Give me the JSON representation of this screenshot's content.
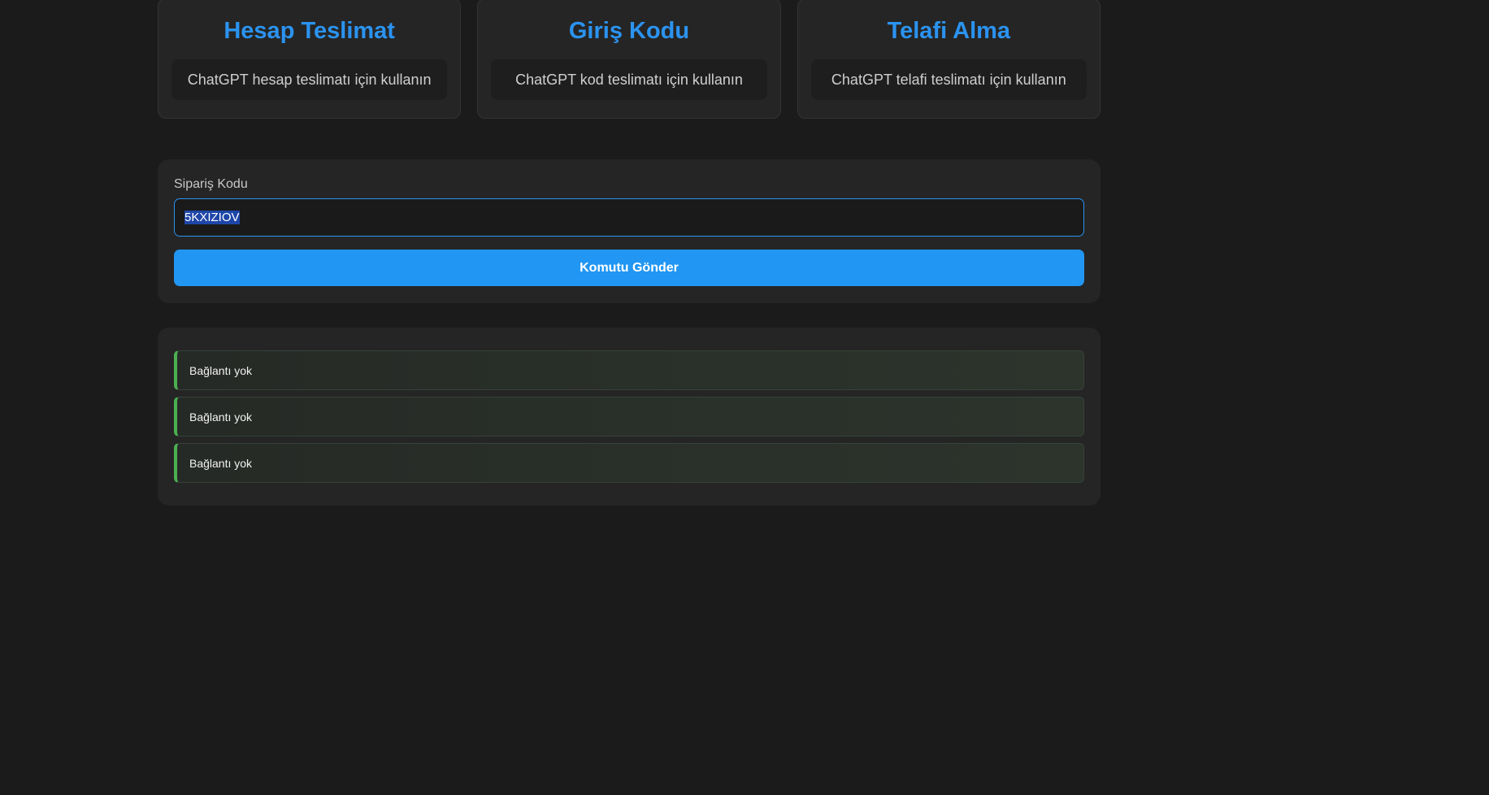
{
  "cards": [
    {
      "title": "Hesap Teslimat",
      "description": "ChatGPT hesap teslimatı için kullanın"
    },
    {
      "title": "Giriş Kodu",
      "description": "ChatGPT kod teslimatı için kullanın"
    },
    {
      "title": "Telafi Alma",
      "description": "ChatGPT telafi teslimatı için kullanın"
    }
  ],
  "form": {
    "label": "Sipariş Kodu",
    "input_value": "5KXIZIOV",
    "submit_label": "Komutu Gönder"
  },
  "status": {
    "items": [
      {
        "text": "Bağlantı yok"
      },
      {
        "text": "Bağlantı yok"
      },
      {
        "text": "Bağlantı yok"
      }
    ]
  },
  "colors": {
    "accent": "#2196f3",
    "title_blue": "#2b93f0",
    "status_green": "#4caf50",
    "background": "#1b1b1b",
    "panel": "#252525"
  }
}
